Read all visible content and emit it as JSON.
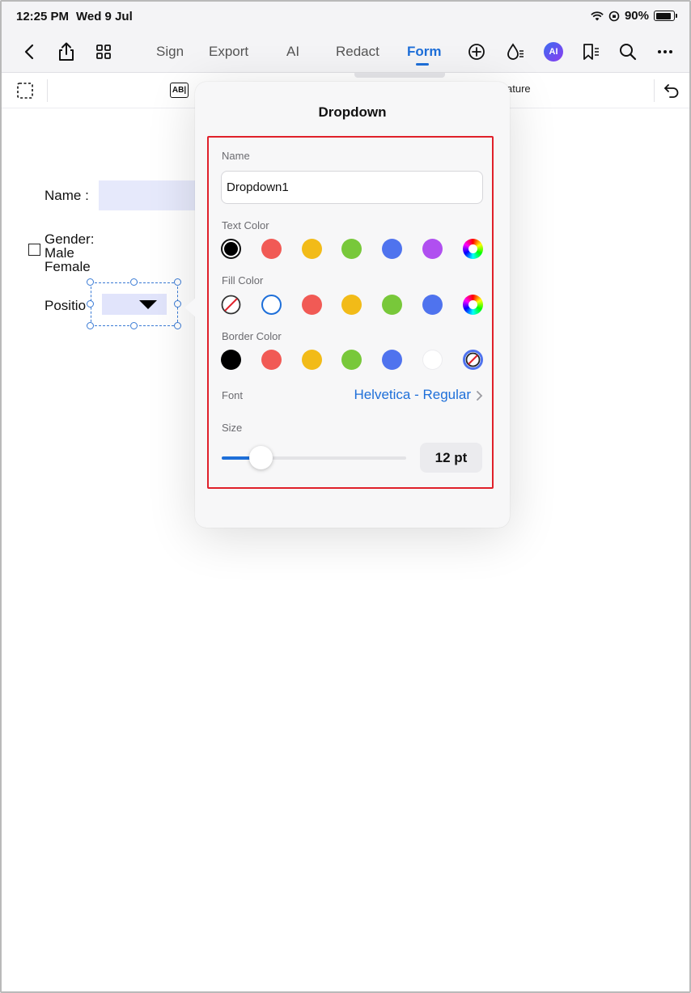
{
  "status_bar": {
    "time": "12:25 PM",
    "date": "Wed 9 Jul",
    "battery": "90%",
    "battery_level": 0.9
  },
  "toolbar": {
    "tabs": [
      {
        "label": "Sign"
      },
      {
        "label": "Export"
      },
      {
        "label": "AI"
      },
      {
        "label": "Redact"
      },
      {
        "label": "Form",
        "active": true
      }
    ],
    "ai_badge": "AI",
    "icons": [
      "back-icon",
      "share-icon",
      "grid-icon",
      "add-icon",
      "water-drop-icon",
      "ai-icon",
      "bookmark-icon",
      "search-icon",
      "more-icon"
    ]
  },
  "subtoolbar": {
    "field_icon": "AB|",
    "partial_label": "ature",
    "icons": [
      "select-icon",
      "text-field-icon",
      "undo-icon"
    ]
  },
  "document": {
    "name_label": "Name :",
    "gender_label": "Gender:",
    "male_label": "Male",
    "female_label": "Female",
    "position_label": "Positio"
  },
  "popover": {
    "title": "Dropdown",
    "name": {
      "label": "Name",
      "value": "Dropdown1"
    },
    "text_color": {
      "label": "Text Color",
      "swatches": [
        "#000000",
        "#f15a55",
        "#f2bb18",
        "#78c83a",
        "#4f73ee",
        "#b04ff0",
        "spectrum"
      ],
      "selected": 0
    },
    "fill_color": {
      "label": "Fill Color",
      "swatches": [
        "none",
        "outline-blue",
        "#f15a55",
        "#f2bb18",
        "#78c83a",
        "#4f73ee",
        "spectrum"
      ]
    },
    "border_color": {
      "label": "Border Color",
      "swatches": [
        "#000000",
        "#f15a55",
        "#f2bb18",
        "#78c83a",
        "#4f73ee",
        "#ffffff",
        "none-spectrum"
      ]
    },
    "font": {
      "label": "Font",
      "value": "Helvetica - Regular"
    },
    "size": {
      "label": "Size",
      "value": "12 pt",
      "slider_fraction": 0.21
    }
  },
  "colors": {
    "accent": "#1e6fd9",
    "highlight": "#e0202a"
  }
}
